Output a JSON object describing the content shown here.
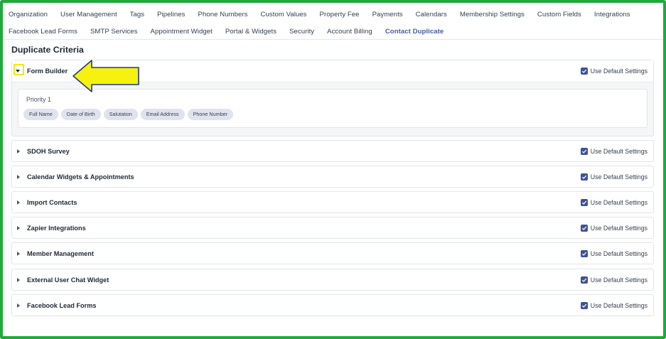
{
  "nav": {
    "row1": [
      "Organization",
      "User Management",
      "Tags",
      "Pipelines",
      "Phone Numbers",
      "Custom Values",
      "Property Fee",
      "Payments",
      "Calendars",
      "Membership Settings",
      "Custom Fields",
      "Integrations"
    ],
    "row2": [
      "Facebook Lead Forms",
      "SMTP Services",
      "Appointment Widget",
      "Portal & Widgets",
      "Security",
      "Account Billing",
      "Contact Duplicate"
    ],
    "active": "Contact Duplicate"
  },
  "page": {
    "title": "Duplicate Criteria"
  },
  "default_settings_label": "Use Default Settings",
  "open_panel": {
    "label": "Form Builder",
    "priority_label": "Priority 1",
    "chips": [
      "Full Name",
      "Date of Birth",
      "Salutation",
      "Email Address",
      "Phone Number"
    ]
  },
  "collapsed_panels": [
    "SDOH Survey",
    "Calendar Widgets & Appointments",
    "Import Contacts",
    "Zapier Integrations",
    "Member Management",
    "External User Chat Widget",
    "Facebook Lead Forms"
  ],
  "colors": {
    "accent": "#3e5296",
    "frame_border": "#1faa3a",
    "annotation_arrow": "#f6f10e"
  }
}
